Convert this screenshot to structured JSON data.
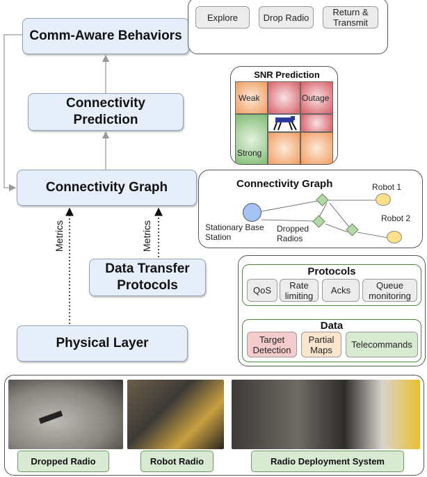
{
  "layers": {
    "comm_aware": "Comm-Aware Behaviors",
    "prediction": "Connectivity Prediction",
    "graph": "Connectivity Graph",
    "protocols": "Data Transfer Protocols",
    "physical": "Physical Layer"
  },
  "metrics_label": "Metrics",
  "behaviors": {
    "steps": [
      "Explore",
      "Drop Radio",
      "Return & Transmit"
    ]
  },
  "snr": {
    "title": "SNR Prediction",
    "labels": {
      "weak": "Weak",
      "outage": "Outage",
      "strong": "Strong"
    },
    "colors": {
      "weak": "#f2a36a",
      "outage": "#d96b72",
      "strong": "#88c07d"
    }
  },
  "conn_graph": {
    "title": "Connectivity Graph",
    "base_station": "Stationary Base Station",
    "dropped_radios": "Dropped Radios",
    "robot1": "Robot 1",
    "robot2": "Robot 2"
  },
  "protocols_panel": {
    "title": "Protocols",
    "items": [
      "QoS",
      "Rate limiting",
      "Acks",
      "Queue monitoring"
    ],
    "data_title": "Data",
    "data_items": [
      "Target Detection",
      "Partial Maps",
      "Telecommands"
    ]
  },
  "hardware": {
    "labels": [
      "Dropped Radio",
      "Robot Radio",
      "Radio Deployment System"
    ]
  }
}
